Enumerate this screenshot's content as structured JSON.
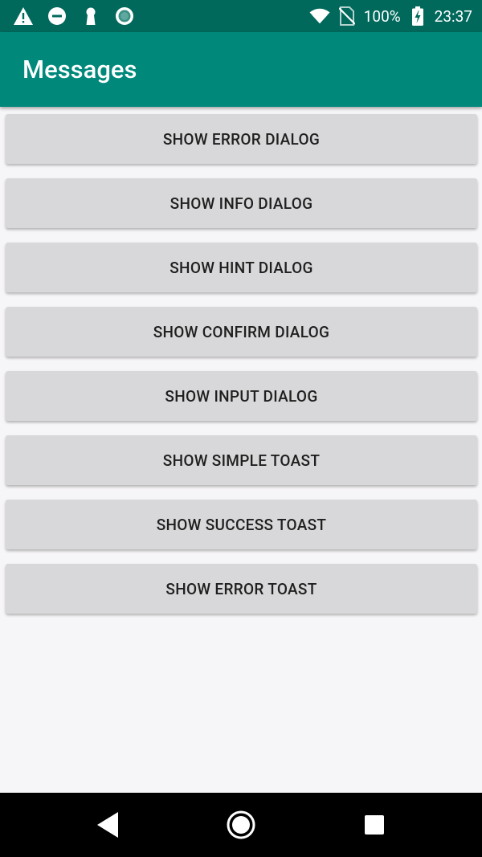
{
  "status_bar": {
    "battery": "100%",
    "time": "23:37",
    "icons": [
      "warning-icon",
      "do-not-disturb-icon",
      "keyhole-icon",
      "sync-icon",
      "wifi-icon",
      "no-sim-icon",
      "battery-icon"
    ]
  },
  "app_bar": {
    "title": "Messages",
    "color": "#00897b",
    "status_color": "#00695c"
  },
  "buttons": [
    "SHOW ERROR DIALOG",
    "SHOW INFO DIALOG",
    "SHOW HINT DIALOG",
    "SHOW CONFIRM DIALOG",
    "SHOW INPUT DIALOG",
    "SHOW SIMPLE TOAST",
    "SHOW SUCCESS TOAST",
    "SHOW ERROR TOAST"
  ],
  "nav_bar": {
    "icons": [
      "back-icon",
      "home-icon",
      "recent-apps-icon"
    ]
  }
}
